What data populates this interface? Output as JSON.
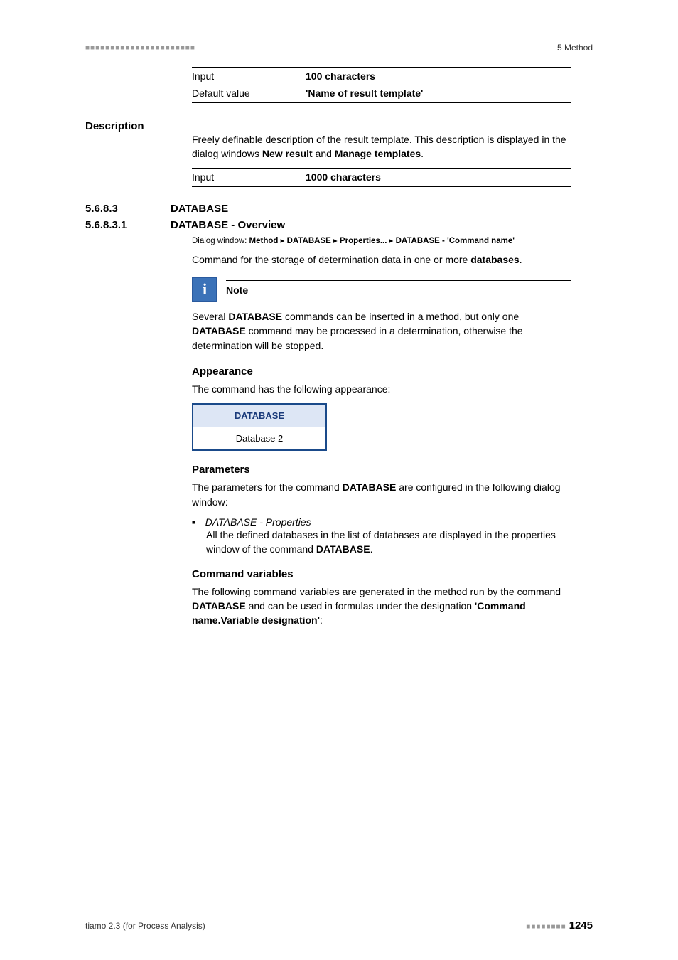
{
  "header": {
    "dots": "■■■■■■■■■■■■■■■■■■■■■■",
    "crumb": "5 Method"
  },
  "table1": {
    "row1": {
      "k": "Input",
      "v": "100 characters"
    },
    "row2": {
      "k": "Default value",
      "v": "'Name of result template'"
    }
  },
  "desc": {
    "heading": "Description",
    "text_a": "Freely definable description of the result template. This description is displayed in the dialog windows ",
    "bold1": "New result",
    "and": " and ",
    "bold2": "Manage templates",
    "dot": "."
  },
  "table2": {
    "row1": {
      "k": "Input",
      "v": "1000 characters"
    }
  },
  "sec1": {
    "num": "5.6.8.3",
    "title": "DATABASE"
  },
  "sec2": {
    "num": "5.6.8.3.1",
    "title": "DATABASE - Overview"
  },
  "dialog": {
    "label": "Dialog window: ",
    "p1": "Method",
    "sep": " ▸ ",
    "p2": "DATABASE",
    "p3": "Properties...",
    "p4": "DATABASE - 'Command name'"
  },
  "cmd": {
    "pre": "Command for the storage of determination data in one or more ",
    "b": "databases",
    "dot": "."
  },
  "note": {
    "title": "Note",
    "t1": "Several ",
    "b1": "DATABASE",
    "t2": " commands can be inserted in a method, but only one ",
    "b2": "DATABASE",
    "t3": " command may be processed in a determination, otherwise the determination will be stopped."
  },
  "appearance": {
    "h": "Appearance",
    "text": "The command has the following appearance:",
    "widget_top": "DATABASE",
    "widget_bot": "Database 2"
  },
  "params": {
    "h": "Parameters",
    "t1": "The parameters for the command ",
    "b1": "DATABASE",
    "t2": " are configured in the following dialog window:",
    "li1": "DATABASE - Properties",
    "sub1a": "All the defined databases in the list of databases are displayed in the properties window of the command ",
    "sub1b": "DATABASE",
    "sub1c": "."
  },
  "cmdvars": {
    "h": "Command variables",
    "t1": "The following command variables are generated in the method run by the command ",
    "b1": "DATABASE",
    "t2": " and can be used in formulas under the designation ",
    "b2": "'Command name.Variable designation'",
    "t3": ":"
  },
  "footer": {
    "left": "tiamo 2.3 (for Process Analysis)",
    "dots": "■■■■■■■■",
    "page": "1245"
  }
}
